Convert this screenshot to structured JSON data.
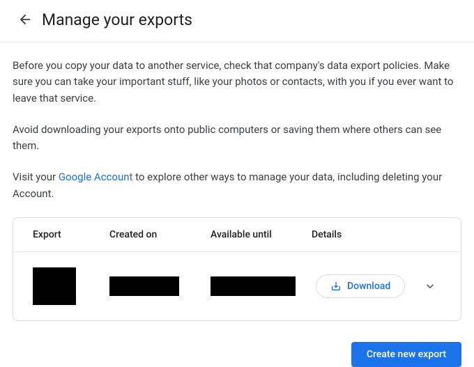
{
  "header": {
    "title": "Manage your exports"
  },
  "intro": {
    "para1": "Before you copy your data to another service, check that company's data export policies. Make sure you can take your important stuff, like your photos or contacts, with you if you ever want to leave that service.",
    "para2": "Avoid downloading your exports onto public computers or saving them where others can see them.",
    "para3_prefix": "Visit your ",
    "para3_link": "Google Account",
    "para3_suffix": " to explore other ways to manage your data, including deleting your Account."
  },
  "table": {
    "columns": {
      "export": "Export",
      "created": "Created on",
      "available": "Available until",
      "details": "Details"
    },
    "row": {
      "download_label": "Download"
    }
  },
  "actions": {
    "create_label": "Create new export"
  }
}
